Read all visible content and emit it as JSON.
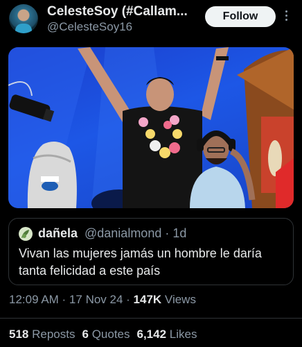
{
  "header": {
    "display_name": "CelesteSoy (#Callam...",
    "handle": "@CelesteSoy16",
    "follow_label": "Follow",
    "more_icon": "more-vertical-icon"
  },
  "quote": {
    "name": "dañela",
    "handle_time": "@danialmond · 1d",
    "text": "Vivan las mujeres jamás un hombre le daría tanta felicidad a este país"
  },
  "meta": {
    "time_date": "12:09 AM · 17 Nov 24 · ",
    "views_count": "147K",
    "views_label": " Views"
  },
  "stats": {
    "reposts_count": "518",
    "reposts_label": "Reposts",
    "quotes_count": "6",
    "quotes_label": "Quotes",
    "likes_count": "6,142",
    "likes_label": "Likes"
  }
}
